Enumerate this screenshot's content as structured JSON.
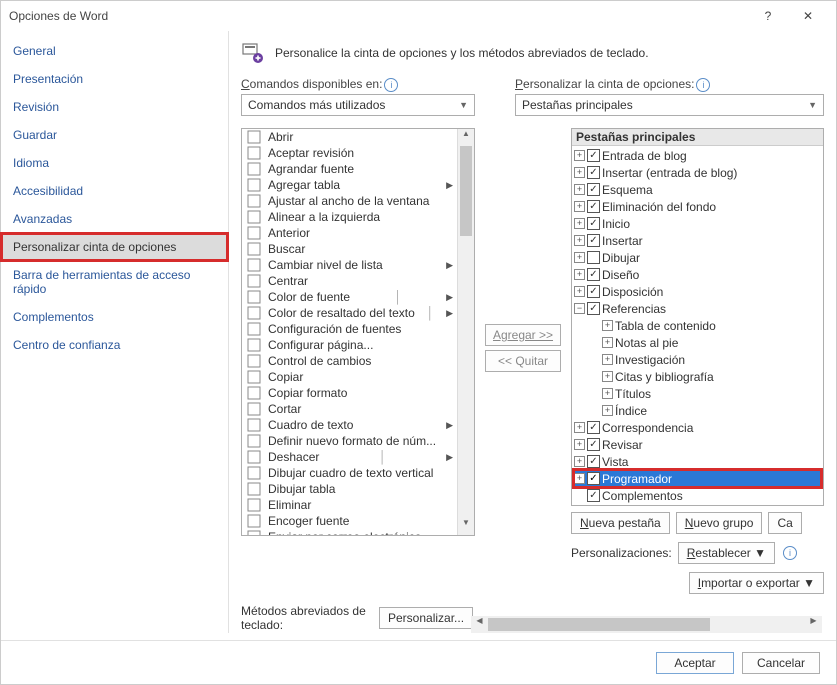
{
  "window": {
    "title": "Opciones de Word"
  },
  "nav": {
    "items": [
      {
        "label": "General"
      },
      {
        "label": "Presentación"
      },
      {
        "label": "Revisión"
      },
      {
        "label": "Guardar"
      },
      {
        "label": "Idioma"
      },
      {
        "label": "Accesibilidad"
      },
      {
        "label": "Avanzadas"
      },
      {
        "label": "Personalizar cinta de opciones",
        "selected": true,
        "highlight": true
      },
      {
        "label": "Barra de herramientas de acceso rápido"
      },
      {
        "label": "Complementos"
      },
      {
        "label": "Centro de confianza"
      }
    ]
  },
  "header": {
    "text": "Personalice la cinta de opciones y los métodos abreviados de teclado."
  },
  "left": {
    "label_pre": "C",
    "label_rest": "omandos disponibles en:",
    "select_value": "Comandos más utilizados",
    "commands": [
      {
        "label": "Abrir"
      },
      {
        "label": "Aceptar revisión"
      },
      {
        "label": "Agrandar fuente"
      },
      {
        "label": "Agregar tabla",
        "sub": true
      },
      {
        "label": "Ajustar al ancho de la ventana"
      },
      {
        "label": "Alinear a la izquierda"
      },
      {
        "label": "Anterior"
      },
      {
        "label": "Buscar"
      },
      {
        "label": "Cambiar nivel de lista",
        "sub": true
      },
      {
        "label": "Centrar"
      },
      {
        "label": "Color de fuente",
        "sub": true,
        "split": true
      },
      {
        "label": "Color de resaltado del texto",
        "sub": true,
        "split": true
      },
      {
        "label": "Configuración de fuentes"
      },
      {
        "label": "Configurar página..."
      },
      {
        "label": "Control de cambios"
      },
      {
        "label": "Copiar"
      },
      {
        "label": "Copiar formato"
      },
      {
        "label": "Cortar"
      },
      {
        "label": "Cuadro de texto",
        "sub": true
      },
      {
        "label": "Definir nuevo formato de núm..."
      },
      {
        "label": "Deshacer",
        "sub": true,
        "split": true
      },
      {
        "label": "Dibujar cuadro de texto vertical"
      },
      {
        "label": "Dibujar tabla"
      },
      {
        "label": "Eliminar"
      },
      {
        "label": "Encoger fuente"
      },
      {
        "label": "Enviar por correo electrónico"
      }
    ]
  },
  "mid": {
    "add": "Agregar >>",
    "remove": "<< Quitar"
  },
  "right": {
    "label_pre": "P",
    "label_rest": "ersonalizar la cinta de opciones:",
    "select_value": "Pestañas principales",
    "tree_header": "Pestañas principales",
    "nodes": [
      {
        "label": "Entrada de blog",
        "checked": true
      },
      {
        "label": "Insertar (entrada de blog)",
        "checked": true
      },
      {
        "label": "Esquema",
        "checked": true
      },
      {
        "label": "Eliminación del fondo",
        "checked": true
      },
      {
        "label": "Inicio",
        "checked": true
      },
      {
        "label": "Insertar",
        "checked": true
      },
      {
        "label": "Dibujar",
        "checked": false
      },
      {
        "label": "Diseño",
        "checked": true
      },
      {
        "label": "Disposición",
        "checked": true
      }
    ],
    "ref_node": {
      "label": "Referencias",
      "checked": true,
      "expanded": true
    },
    "ref_children": [
      "Tabla de contenido",
      "Notas al pie",
      "Investigación",
      "Citas y bibliografía",
      "Títulos",
      "Índice"
    ],
    "nodes2": [
      {
        "label": "Correspondencia",
        "checked": true
      },
      {
        "label": "Revisar",
        "checked": true
      },
      {
        "label": "Vista",
        "checked": true
      }
    ],
    "prog_node": {
      "label": "Programador",
      "checked": true,
      "selected": true,
      "highlight": true
    },
    "comp_node": {
      "label": "Complementos",
      "checked": true
    },
    "buttons": {
      "new_tab_pre": "N",
      "new_tab_rest": "ueva pestaña",
      "new_group_pre": "N",
      "new_group_rest": "uevo grupo",
      "rename": "Ca"
    },
    "cust_label": "Personalizaciones:",
    "reset_pre": "R",
    "reset_rest": "establecer",
    "import_pre": "I",
    "import_rest": "mportar o exportar"
  },
  "kbd": {
    "label": "Métodos abreviados de teclado:",
    "button": "Personalizar..."
  },
  "footer": {
    "ok": "Aceptar",
    "cancel": "Cancelar"
  }
}
